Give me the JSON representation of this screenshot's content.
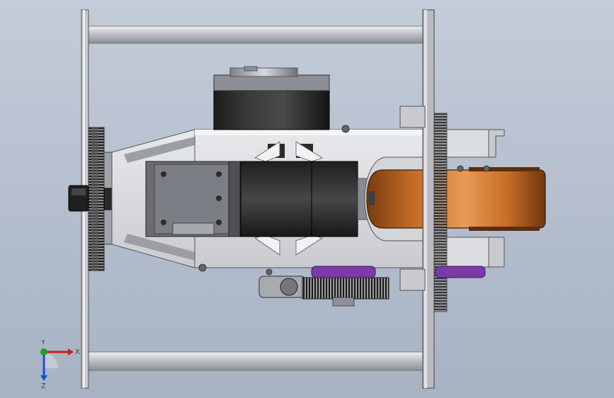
{
  "viewport": {
    "background_top": "#c4ccd9",
    "background_bottom": "#a7b2c3"
  },
  "model": {
    "view": "cad-assembly-top-view",
    "motor_color": "#2b2b2b",
    "frame_color": "#d9dadc",
    "belt_color": "#d47a30",
    "accent_purple": "#7a3aa8"
  },
  "triad": {
    "x_label": "X",
    "y_label": "Y",
    "z_label": "Z",
    "x_color": "#d11a1a",
    "y_color": "#1a4fd1",
    "z_color": "#1aa51a"
  }
}
